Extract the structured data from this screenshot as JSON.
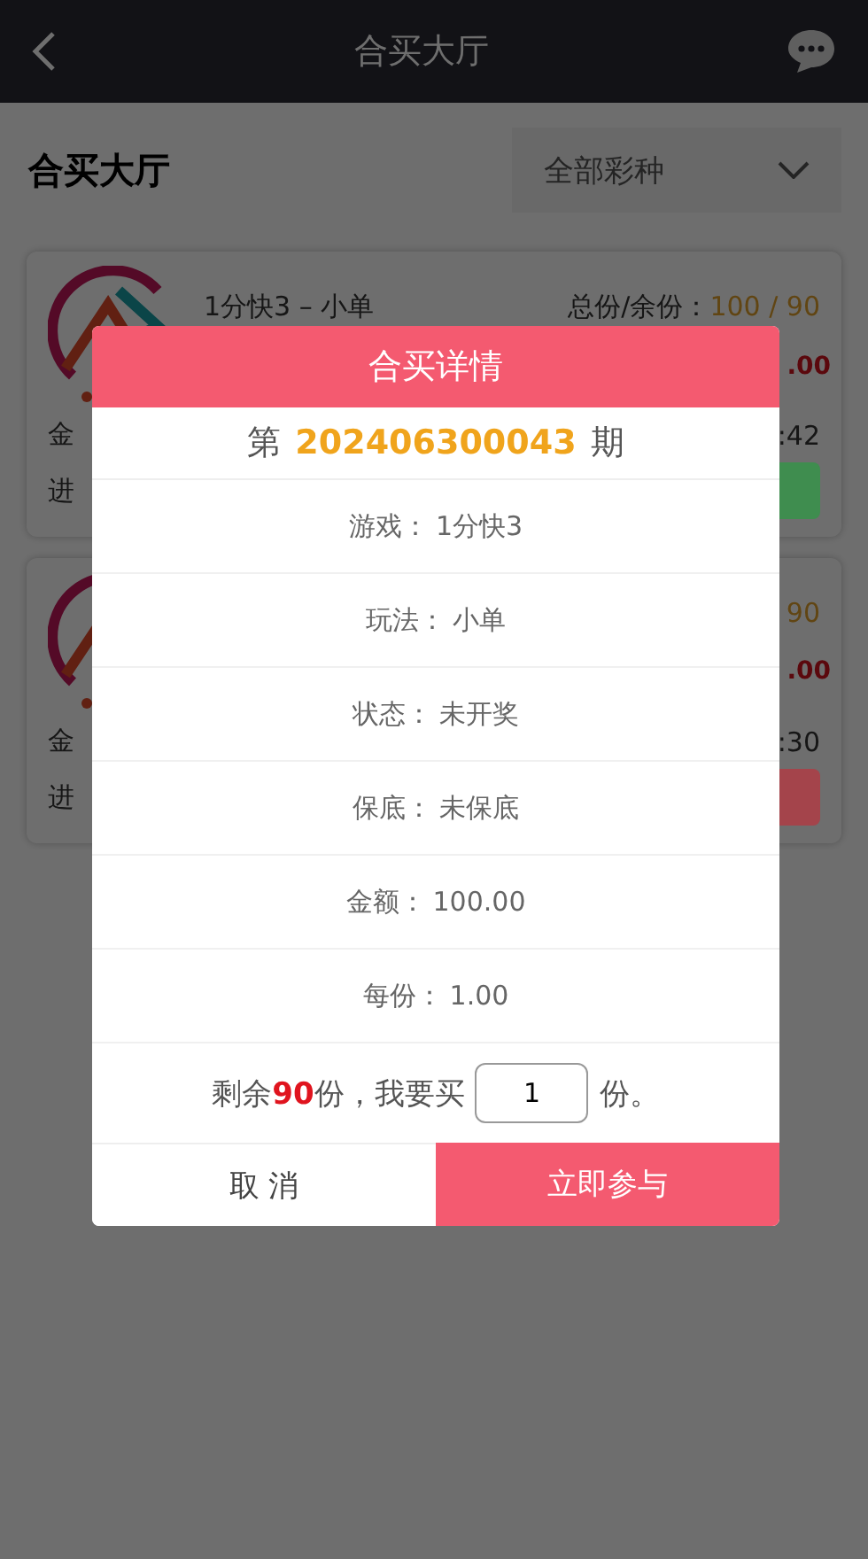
{
  "nav": {
    "title": "合买大厅"
  },
  "hall": {
    "title": "合买大厅",
    "filter": "全部彩种"
  },
  "cards": [
    {
      "title": "1分快3 – 小单",
      "share_label": "总份/余份：",
      "shares": "100 / 90",
      "amount": ".00",
      "amount_label": "金",
      "progress_label": "进",
      "time": ":42",
      "color": "#3f8d4f"
    },
    {
      "shares": "90",
      "amount": ".00",
      "amount_label": "金",
      "progress_label": "进",
      "time": ":30",
      "color": "#a4444b"
    }
  ],
  "dialog": {
    "title": "合买详情",
    "issue_prefix": "第",
    "issue": "202406300043",
    "issue_suffix": "期",
    "rows": [
      {
        "label": "游戏：",
        "value": "1分快3"
      },
      {
        "label": "玩法：",
        "value": "小单"
      },
      {
        "label": "状态：",
        "value": "未开奖"
      },
      {
        "label": "保底：",
        "value": "未保底"
      },
      {
        "label": "金额：",
        "value": "100.00"
      },
      {
        "label": "每份：",
        "value": "1.00"
      }
    ],
    "buy": {
      "text": "剩余**90**份，我要买",
      "quantity": "1",
      "unit": "份。"
    },
    "buttons": [
      {
        "label": "取 消",
        "kind": "cancel"
      },
      {
        "label": "立即参与",
        "kind": "confirm"
      }
    ]
  }
}
